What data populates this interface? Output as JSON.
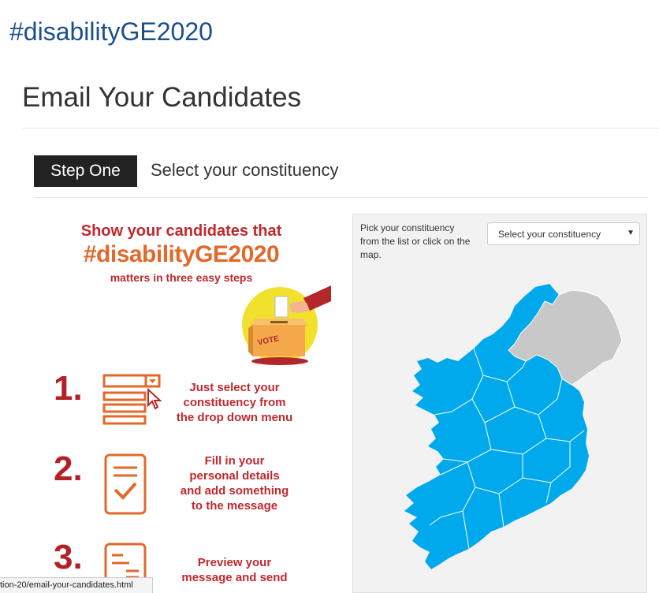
{
  "header": {
    "hashtag": "#disabilityGE2020",
    "title": "Email Your Candidates"
  },
  "step": {
    "badge": "Step One",
    "text": "Select your constituency"
  },
  "infographic": {
    "line1": "Show your candidates that",
    "line2": "#disabilityGE2020",
    "line3": "matters in three easy steps",
    "vote_label": "VOTE",
    "steps": [
      {
        "number": "1.",
        "lines": [
          "Just select your",
          "constituency from",
          "the drop down menu"
        ]
      },
      {
        "number": "2.",
        "lines": [
          "Fill in your",
          "personal details",
          "and add something",
          "to the message"
        ]
      },
      {
        "number": "3.",
        "lines": [
          "Preview your",
          "message and send"
        ]
      }
    ]
  },
  "map_panel": {
    "hint": "Pick your constituency from the list or click on the map.",
    "select_value": "Select your constituency",
    "colors": {
      "republic": "#00a9ec",
      "northern_ireland": "#c8c8c8"
    }
  },
  "status_bar": {
    "url": "tion-20/email-your-candidates.html"
  }
}
